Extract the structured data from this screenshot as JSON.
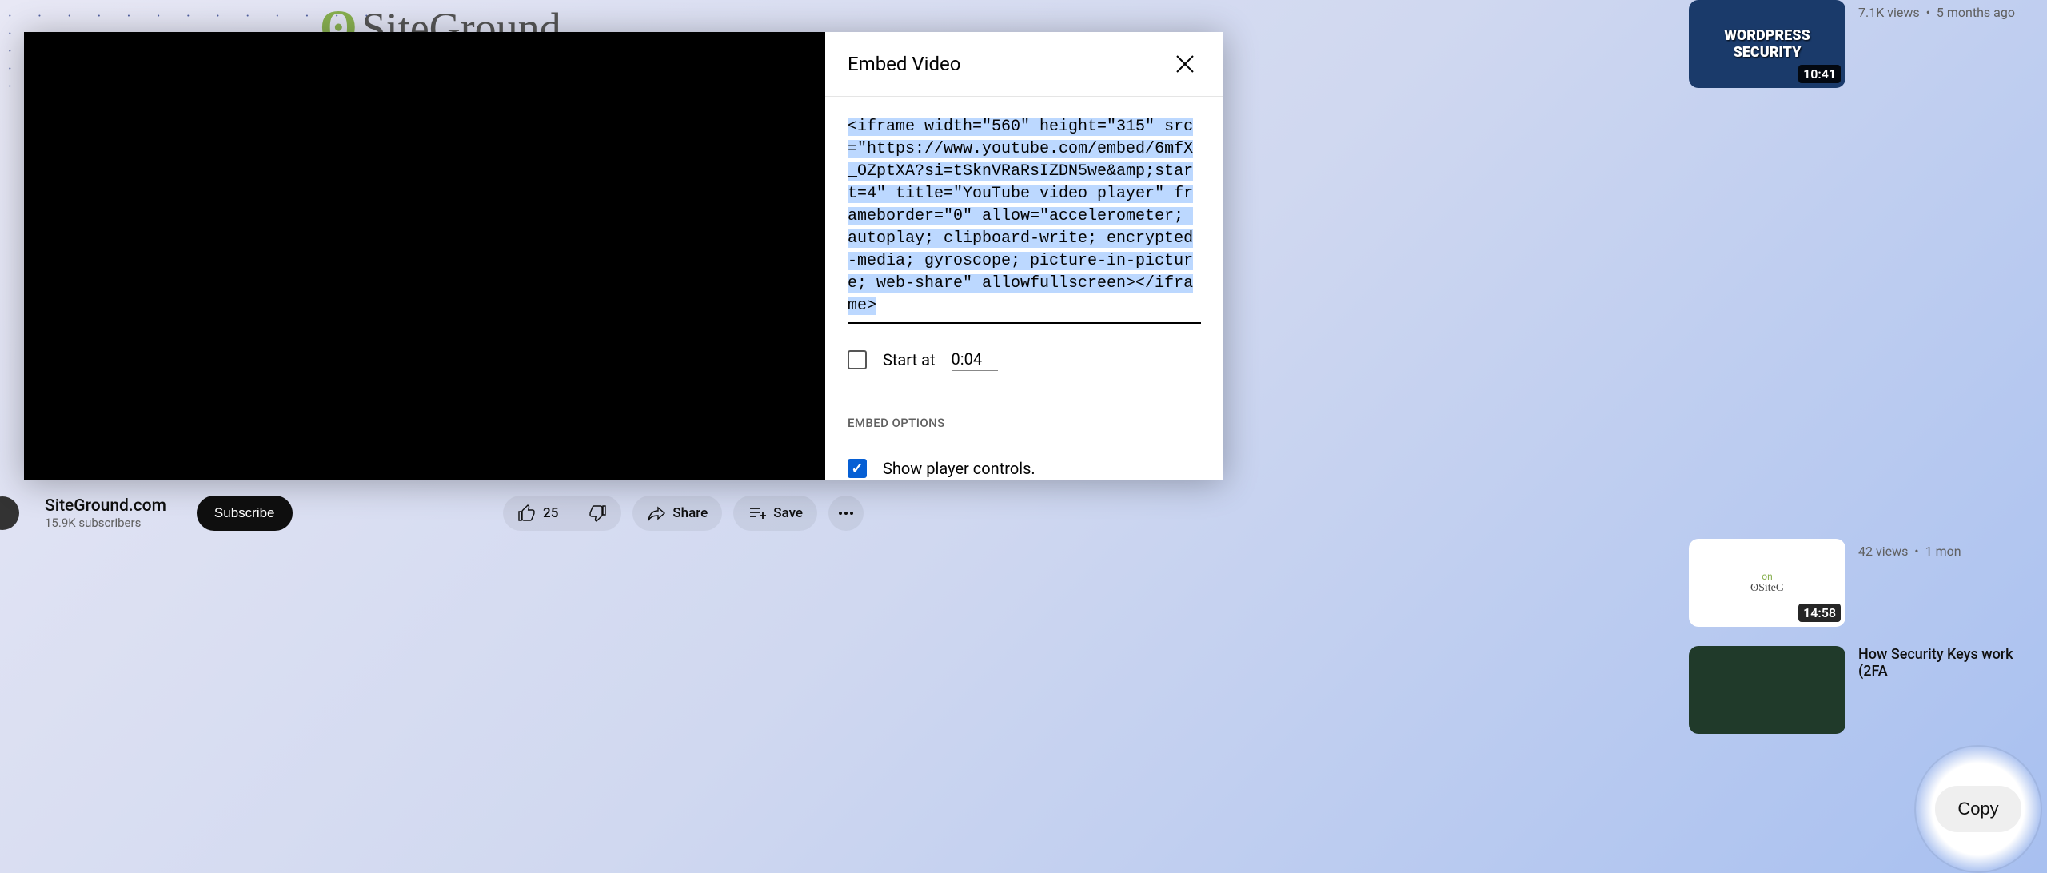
{
  "bg": {
    "brand": "SiteGround"
  },
  "suggestions": [
    {
      "thumb_title": "WORDPRESS SECURITY",
      "duration": "10:41",
      "views": "7.1K views",
      "age": "5 months ago"
    },
    {
      "thumb_overlay_on": "on",
      "thumb_overlay_brand": "SiteG",
      "duration": "14:58",
      "views": "42 views",
      "age": "1 mon"
    },
    {
      "title_partial": "How Security Keys work (2FA"
    }
  ],
  "modal": {
    "title": "Embed Video",
    "embed_code": "<iframe width=\"560\" height=\"315\" src=\"https://www.youtube.com/embed/6mfX_OZptXA?si=tSknVRaRsIZDN5we&amp;start=4\" title=\"YouTube video player\" frameborder=\"0\" allow=\"accelerometer; autoplay; clipboard-write; encrypted-media; gyroscope; picture-in-picture; web-share\" allowfullscreen></iframe>",
    "start_at_label": "Start at",
    "start_at_value": "0:04",
    "start_at_checked": false,
    "embed_options_header": "EMBED OPTIONS",
    "show_controls_label": "Show player controls.",
    "show_controls_checked": true,
    "copy_label": "Copy"
  },
  "video": {
    "channel_name": "SiteGround.com",
    "subscribers": "15.9K subscribers",
    "subscribe": "Subscribe",
    "like_count": "25",
    "share_label": "Share",
    "save_label": "Save"
  }
}
